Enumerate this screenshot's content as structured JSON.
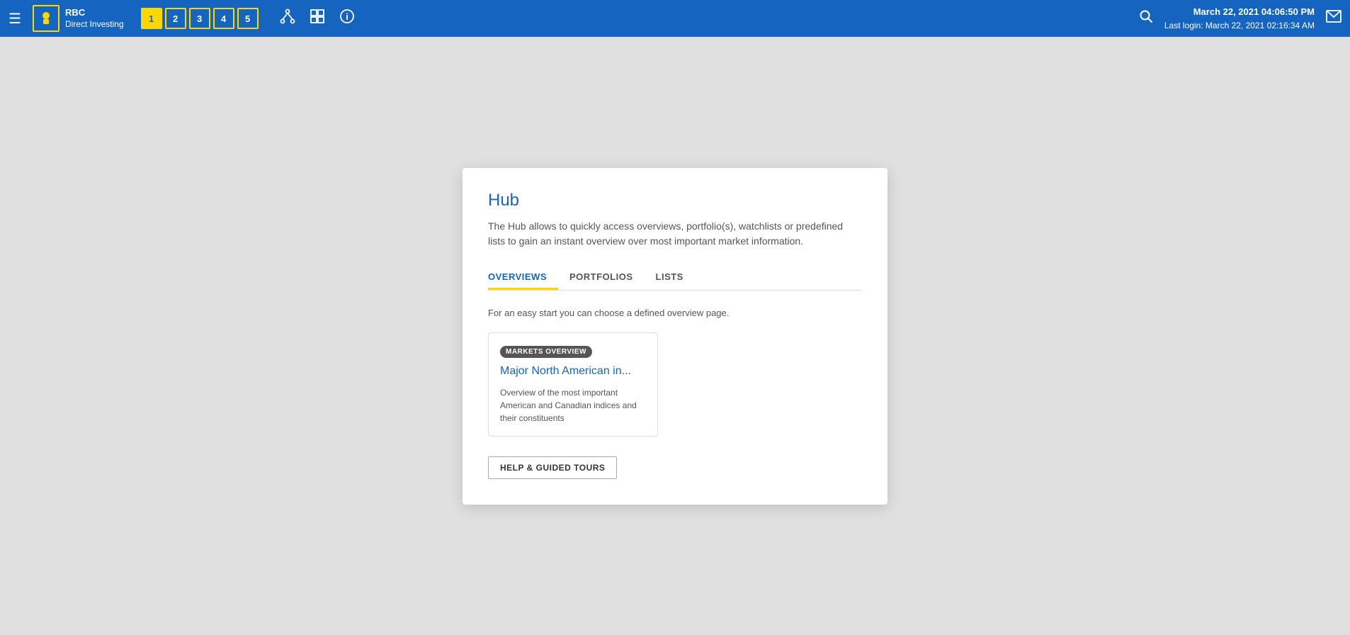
{
  "navbar": {
    "hamburger": "≡",
    "brand_name": "Direct Investing",
    "rbc_logo_text": "RBC",
    "tabs": [
      {
        "label": "1",
        "active": true
      },
      {
        "label": "2",
        "active": false
      },
      {
        "label": "3",
        "active": false
      },
      {
        "label": "4",
        "active": false
      },
      {
        "label": "5",
        "active": false
      }
    ],
    "datetime_main": "March 22, 2021 04:06:50 PM",
    "datetime_sub": "Last login: March 22, 2021 02:16:34 AM"
  },
  "hub": {
    "title": "Hub",
    "description": "The Hub allows to quickly access overviews, portfolio(s), watchlists or predefined lists to gain an instant overview over most important market information.",
    "tabs": [
      {
        "label": "OVERVIEWS",
        "active": true
      },
      {
        "label": "PORTFOLIOS",
        "active": false
      },
      {
        "label": "LISTS",
        "active": false
      }
    ],
    "tab_content": "For an easy start you can choose a defined overview page.",
    "card": {
      "badge": "MARKETS OVERVIEW",
      "title": "Major North American in...",
      "description": "Overview of the most important American and Canadian indices and their constituents"
    },
    "help_button": "HELP & GUIDED TOURS"
  }
}
